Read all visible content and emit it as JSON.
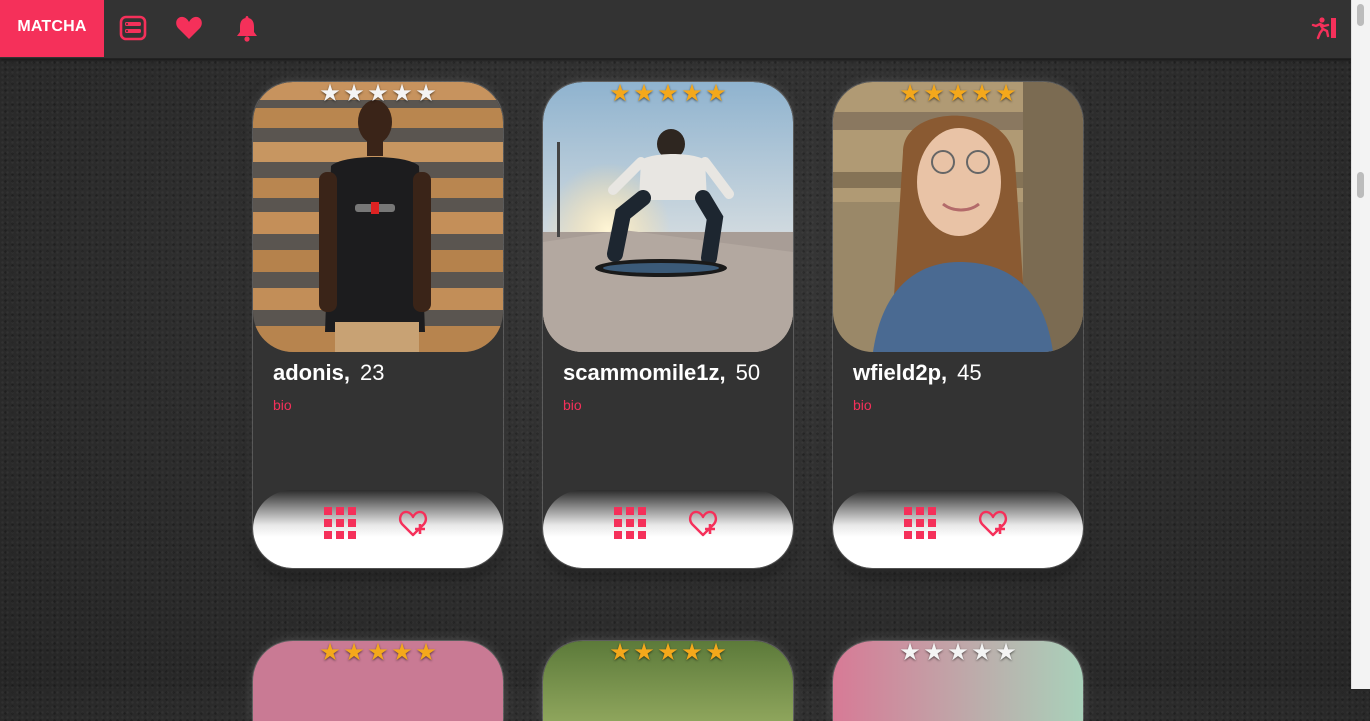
{
  "app": {
    "brand": "MATCHA",
    "accent_color": "#f5305a"
  },
  "nav": {
    "icons": [
      "profile-card-icon",
      "heart-icon",
      "bell-icon"
    ],
    "logout_icon": "logout-runner-icon"
  },
  "cards": [
    {
      "name": "adonis,",
      "age": "23",
      "bio": "bio",
      "rating": 0,
      "star_color": "white"
    },
    {
      "name": "scammomile1z,",
      "age": "50",
      "bio": "bio",
      "rating": 5,
      "star_color": "gold"
    },
    {
      "name": "wfield2p,",
      "age": "45",
      "bio": "bio",
      "rating": 5,
      "star_color": "gold"
    }
  ],
  "second_row_cards": [
    {
      "rating": 5,
      "star_color": "gold"
    },
    {
      "rating": 5,
      "star_color": "gold"
    },
    {
      "rating": 0,
      "star_color": "white"
    }
  ],
  "card_actions": {
    "grid_icon": "grid-icon",
    "like_icon": "heart-plus-icon"
  }
}
